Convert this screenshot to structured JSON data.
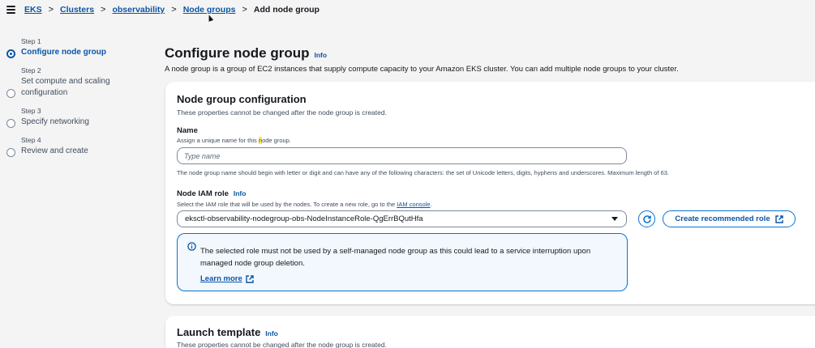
{
  "breadcrumb": {
    "items": [
      "EKS",
      "Clusters",
      "observability",
      "Node groups"
    ],
    "current": "Add node group"
  },
  "steps": [
    {
      "num": "Step 1",
      "title": "Configure node group",
      "active": true
    },
    {
      "num": "Step 2",
      "title": "Set compute and scaling configuration",
      "active": false
    },
    {
      "num": "Step 3",
      "title": "Specify networking",
      "active": false
    },
    {
      "num": "Step 4",
      "title": "Review and create",
      "active": false
    }
  ],
  "page": {
    "title": "Configure node group",
    "info": "Info",
    "description": "A node group is a group of EC2 instances that supply compute capacity to your Amazon EKS cluster. You can add multiple node groups to your cluster."
  },
  "node_group_config": {
    "title": "Node group configuration",
    "subtitle": "These properties cannot be changed after the node group is created.",
    "name_label": "Name",
    "name_desc_pre": "Assign a unique name for this ",
    "name_desc_hl": "n",
    "name_desc_post": "ode group.",
    "name_placeholder": "Type name",
    "name_constraint": "The node group name should begin with letter or digit and can have any of the following characters: the set of Unicode letters, digits, hyphens and underscores. Maximum length of 63.",
    "iam_label": "Node IAM role",
    "iam_info": "Info",
    "iam_desc": "Select the IAM role that will be used by the nodes. To create a new role, go to the",
    "iam_console_link": "IAM console",
    "iam_selected": "eksctl-observability-nodegroup-obs-NodeInstanceRole-QgErrBQutHfa",
    "create_role_button": "Create recommended role",
    "alert_text": "The selected role must not be used by a self-managed node group as this could lead to a service interruption upon managed node group deletion.",
    "alert_link": "Learn more"
  },
  "launch_template": {
    "title": "Launch template",
    "info": "Info",
    "subtitle": "These properties cannot be changed after the node group is created."
  },
  "colors": {
    "link": "#0a55a5",
    "accent": "#0972d3",
    "alert_bg": "#f2f8fd",
    "highlight": "#ffe84d"
  }
}
